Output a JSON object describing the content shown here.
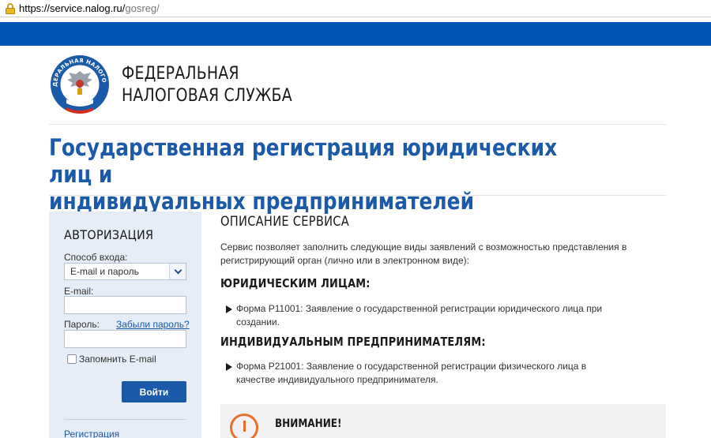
{
  "browser": {
    "url_host": "https://service.nalog.ru/",
    "url_path": "gosreg/"
  },
  "header": {
    "brand_line1": "ФЕДЕРАЛЬНАЯ",
    "brand_line2": "НАЛОГОВАЯ СЛУЖБА",
    "logo_text": "ФЕДЕРАЛЬНАЯ НАЛОГОВАЯ СЛУЖБА"
  },
  "page": {
    "title_line1": "Государственная регистрация юридических лиц и",
    "title_line2": "индивидуальных предпринимателей"
  },
  "auth": {
    "title": "АВТОРИЗАЦИЯ",
    "method_label": "Способ входа:",
    "method_value": "E-mail и пароль",
    "email_label": "E-mail:",
    "email_value": "",
    "password_label": "Пароль:",
    "password_value": "",
    "forgot_link": "Забыли пароль?",
    "remember_label": "Запомнить E-mail",
    "login_button": "Войти",
    "register_link": "Регистрация"
  },
  "content": {
    "heading": "ОПИСАНИЕ СЕРВИСА",
    "description": "Сервис позволяет заполнить следующие виды заявлений с возможностью представления в регистрирующий орган (лично или в электронном виде):",
    "legal_heading": "ЮРИДИЧЕСКИМ ЛИЦАМ:",
    "legal_item": "Форма Р11001: Заявление о государственной регистрации юридического лица при создании.",
    "ip_heading": "ИНДИВИДУАЛЬНЫМ ПРЕДПРИНИМАТЕЛЯМ:",
    "ip_item": "Форма Р21001: Заявление о государственной регистрации физического лица в качестве индивидуального предпринимателя.",
    "notice_title": "ВНИМАНИЕ!"
  },
  "colors": {
    "brand_blue": "#0057b3",
    "title_blue": "#1a5aa8",
    "warning_orange": "#e8702a"
  }
}
